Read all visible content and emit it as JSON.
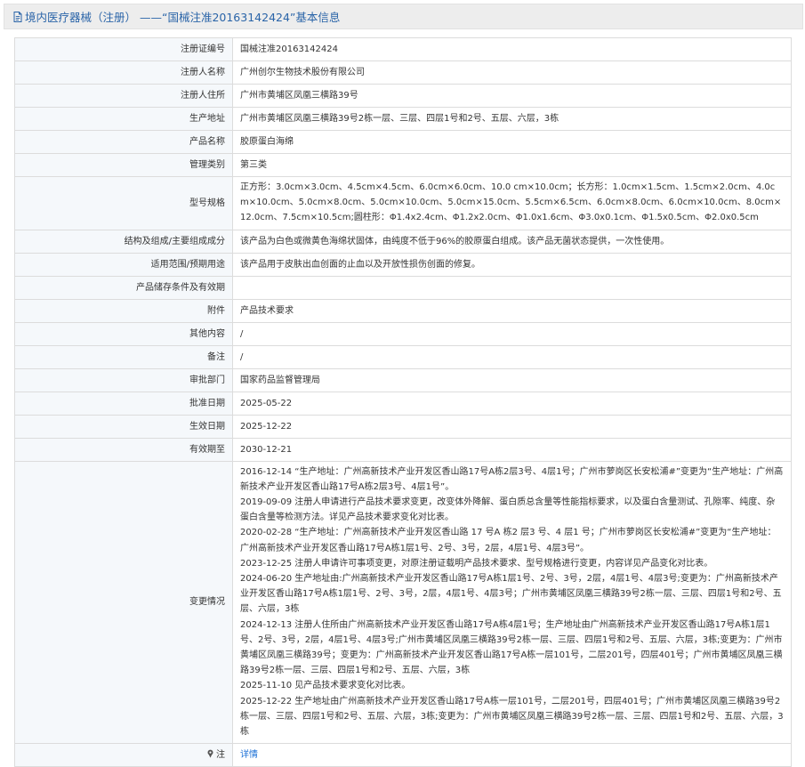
{
  "header": {
    "title": "境内医疗器械（注册） ——“国械注准20163142424”基本信息"
  },
  "rows": [
    {
      "label": "注册证编号",
      "value": "国械注准20163142424"
    },
    {
      "label": "注册人名称",
      "value": "广州创尔生物技术股份有限公司"
    },
    {
      "label": "注册人住所",
      "value": "广州市黄埔区凤凰三横路39号"
    },
    {
      "label": "生产地址",
      "value": "广州市黄埔区凤凰三横路39号2栋一层、三层、四层1号和2号、五层、六层，3栋"
    },
    {
      "label": "产品名称",
      "value": "胶原蛋白海绵"
    },
    {
      "label": "管理类别",
      "value": "第三类"
    },
    {
      "label": "型号规格",
      "value": "正方形：3.0cm×3.0cm、4.5cm×4.5cm、6.0cm×6.0cm、10.0 cm×10.0cm；长方形：1.0cm×1.5cm、1.5cm×2.0cm、4.0cm×10.0cm、5.0cm×8.0cm、5.0cm×10.0cm、5.0cm×15.0cm、5.5cm×6.5cm、6.0cm×8.0cm、6.0cm×10.0cm、8.0cm×12.0cm、7.5cm×10.5cm;圆柱形：Φ1.4x2.4cm、Φ1.2x2.0cm、Φ1.0x1.6cm、Φ3.0x0.1cm、Φ1.5x0.5cm、Φ2.0x0.5cm"
    },
    {
      "label": "结构及组成/主要组成成分",
      "value": "该产品为白色或微黄色海绵状固体，由纯度不低于96%的胶原蛋白组成。该产品无菌状态提供，一次性使用。"
    },
    {
      "label": "适用范围/预期用途",
      "value": "该产品用于皮肤出血创面的止血以及开放性损伤创面的修复。"
    },
    {
      "label": "产品储存条件及有效期",
      "value": ""
    },
    {
      "label": "附件",
      "value": "产品技术要求"
    },
    {
      "label": "其他内容",
      "value": "/"
    },
    {
      "label": "备注",
      "value": "/"
    },
    {
      "label": "审批部门",
      "value": "国家药品监督管理局"
    },
    {
      "label": "批准日期",
      "value": "2025-05-22"
    },
    {
      "label": "生效日期",
      "value": "2025-12-22"
    },
    {
      "label": "有效期至",
      "value": "2030-12-21"
    }
  ],
  "changes": {
    "label": "变更情况",
    "entries": [
      "2016-12-14 “生产地址：广州高新技术产业开发区香山路17号A栋2层3号、4层1号；广州市萝岗区长安松浦#”变更为“生产地址：广州高新技术产业开发区香山路17号A栋2层3号、4层1号”。",
      "2019-09-09 注册人申请进行产品技术要求变更，改变体外降解、蛋白质总含量等性能指标要求，以及蛋白含量测试、孔隙率、纯度、杂蛋白含量等检测方法。详见产品技术要求变化对比表。",
      "2020-02-28 “生产地址：广州高新技术产业开发区香山路 17 号A 栋2 层3 号、4 层1 号；广州市萝岗区长安松浦#”变更为“生产地址：广州高新技术产业开发区香山路17号A栋1层1号、2号、3号，2层，4层1号、4层3号”。",
      "2023-12-25 注册人申请许可事项变更，对原注册证载明产品技术要求、型号规格进行变更，内容详见产品变化对比表。",
      "2024-06-20 生产地址由:广州高新技术产业开发区香山路17号A栋1层1号、2号、3号，2层，4层1号、4层3号;变更为：广州高新技术产业开发区香山路17号A栋1层1号、2号、3号，2层，4层1号、4层3号；广州市黄埔区凤凰三横路39号2栋一层、三层、四层1号和2号、五层、六层，3栋",
      "2024-12-13 注册人住所由广州高新技术产业开发区香山路17号A栋4层1号；生产地址由广州高新技术产业开发区香山路17号A栋1层1号、2号、3号，2层，4层1号、4层3号;广州市黄埔区凤凰三横路39号2栋一层、三层、四层1号和2号、五层、六层，3栋;变更为：广州市黄埔区凤凰三横路39号；变更为：广州高新技术产业开发区香山路17号A栋一层101号，二层201号，四层401号；广州市黄埔区凤凰三横路39号2栋一层、三层、四层1号和2号、五层、六层，3栋",
      "2025-11-10 见产品技术要求变化对比表。",
      "2025-12-22 生产地址由广州高新技术产业开发区香山路17号A栋一层101号，二层201号，四层401号；广州市黄埔区凤凰三横路39号2栋一层、三层、四层1号和2号、五层、六层，3栋;变更为：广州市黄埔区凤凰三横路39号2栋一层、三层、四层1号和2号、五层、六层，3栋"
    ]
  },
  "note": {
    "label": "注",
    "link_text": "详情"
  },
  "colors": {
    "title_text": "#2a64a8",
    "label_bg": "#f5f8fb",
    "border": "#dcdcdc",
    "link": "#1a6fd6"
  },
  "icons": {
    "title": "document-icon",
    "note": "pin-icon"
  }
}
